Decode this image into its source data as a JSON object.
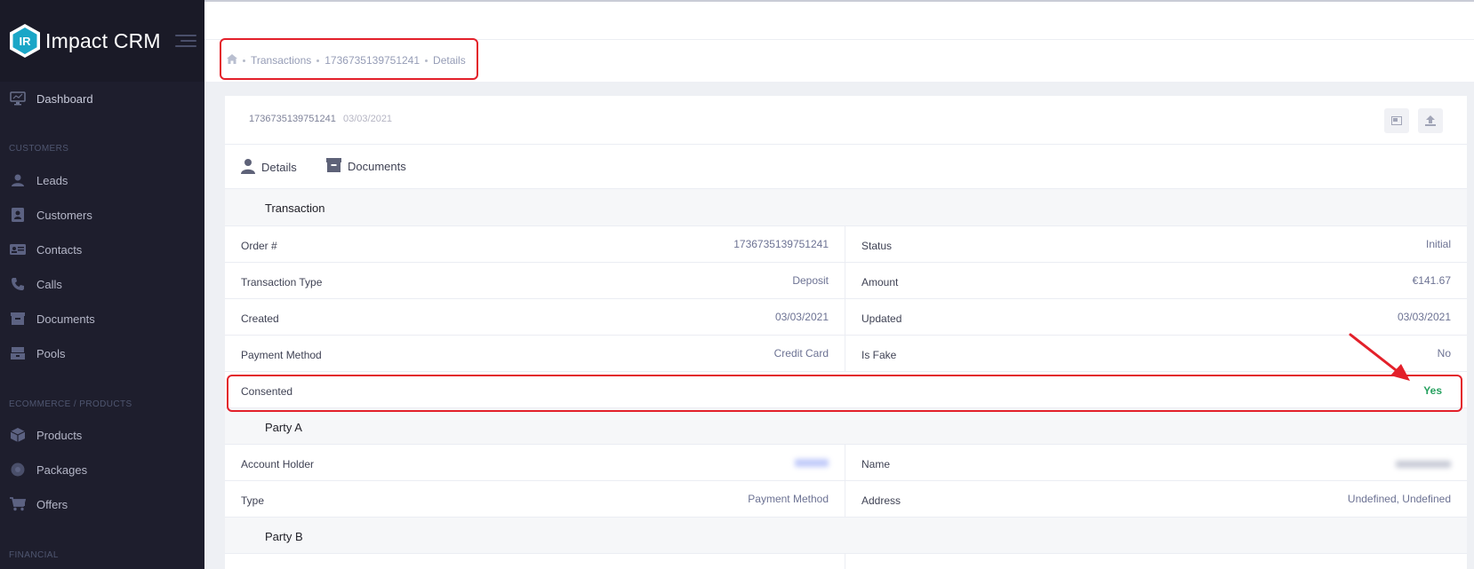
{
  "sidebar": {
    "brand": "Impact CRM",
    "logo_letters": "IR",
    "dashboard": "Dashboard",
    "sections": {
      "customers": "CUSTOMERS",
      "ecommerce": "ECOMMERCE / PRODUCTS",
      "financial": "FINANCIAL"
    },
    "items": {
      "leads": "Leads",
      "customers": "Customers",
      "contacts": "Contacts",
      "calls": "Calls",
      "documents": "Documents",
      "pools": "Pools",
      "products": "Products",
      "packages": "Packages",
      "offers": "Offers"
    }
  },
  "breadcrumb": {
    "home_icon": "home-icon",
    "transactions": "Transactions",
    "id": "1736735139751241",
    "details": "Details"
  },
  "card": {
    "id": "1736735139751241",
    "date": "03/03/2021"
  },
  "tabs": {
    "details": "Details",
    "documents": "Documents"
  },
  "transaction": {
    "title": "Transaction",
    "order_label": "Order #",
    "order_value": "1736735139751241",
    "status_label": "Status",
    "status_value": "Initial",
    "type_label": "Transaction Type",
    "type_value": "Deposit",
    "amount_label": "Amount",
    "amount_value": "€141.67",
    "created_label": "Created",
    "created_value": "03/03/2021",
    "updated_label": "Updated",
    "updated_value": "03/03/2021",
    "payment_label": "Payment Method",
    "payment_value": "Credit Card",
    "fake_label": "Is Fake",
    "fake_value": "No",
    "consented_label": "Consented",
    "consented_value": "Yes"
  },
  "party_a": {
    "title": "Party A",
    "holder_label": "Account Holder",
    "holder_value": "",
    "name_label": "Name",
    "name_value": "",
    "type_label": "Type",
    "type_value": "Payment Method",
    "address_label": "Address",
    "address_value": "Undefined, Undefined"
  },
  "party_b": {
    "title": "Party B"
  },
  "colors": {
    "sidebar_bg": "#1e1e2d",
    "brand_bg": "#1a1a27",
    "accent_teal": "#1aa6c7",
    "highlight_red": "#e3202a",
    "success_green": "#26a15f"
  }
}
